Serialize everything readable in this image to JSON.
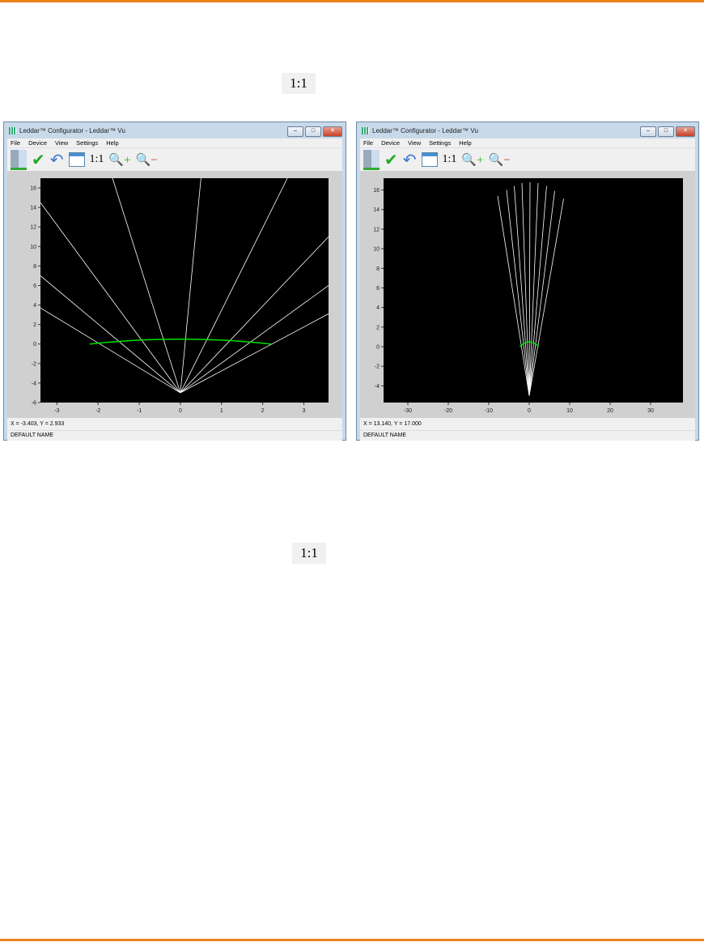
{
  "top_ratio_label": "1:1",
  "bottom_ratio_label": "1:1",
  "windows": [
    {
      "title": "Leddar™ Configurator - Leddar™ Vu",
      "menu": [
        "File",
        "Device",
        "View",
        "Settings",
        "Help"
      ],
      "toolbar_ratio": "1:1",
      "status_coords": "X = -3.403, Y = 2.933",
      "status_name": "DEFAULT NAME"
    },
    {
      "title": "Leddar™ Configurator - Leddar™ Vu",
      "menu": [
        "File",
        "Device",
        "View",
        "Settings",
        "Help"
      ],
      "toolbar_ratio": "1:1",
      "status_coords": "X = 13.140, Y = 17.000",
      "status_name": "DEFAULT NAME"
    }
  ],
  "colors": {
    "accent": "#f0821e",
    "plot_bg": "#000000",
    "rays": "#ffffff",
    "detection": "#00e000"
  },
  "chart_data": [
    {
      "type": "line",
      "xlim": [
        -3.4,
        3.6
      ],
      "ylim": [
        -6,
        17
      ],
      "xticks": [
        -3,
        -2,
        -1,
        0,
        1,
        2,
        3
      ],
      "yticks": [
        -6,
        -4,
        -2,
        0,
        2,
        4,
        6,
        8,
        10,
        12,
        14,
        16
      ],
      "origin": [
        0,
        -5
      ],
      "rays": [
        [
          -3.4,
          14.5
        ],
        [
          -3.4,
          7
        ],
        [
          -3.4,
          3.7
        ],
        [
          -1.65,
          17
        ],
        [
          0.5,
          17
        ],
        [
          2.6,
          17
        ],
        [
          3.6,
          11
        ],
        [
          3.6,
          6
        ],
        [
          3.6,
          3.1
        ]
      ],
      "arc": {
        "x": [
          -2.2,
          2.2
        ],
        "peak_y": 0.5,
        "edge_y": 0
      }
    },
    {
      "type": "line",
      "xlim": [
        -36,
        38
      ],
      "ylim": [
        -5.7,
        17.2
      ],
      "xticks": [
        -30,
        -20,
        -10,
        0,
        10,
        20,
        30
      ],
      "yticks": [
        -4,
        -2,
        0,
        2,
        4,
        6,
        8,
        10,
        12,
        14,
        16
      ],
      "origin": [
        0,
        -5
      ],
      "rays": [
        [
          -7.8,
          15.4
        ],
        [
          -5.6,
          16
        ],
        [
          -3.7,
          16.4
        ],
        [
          -1.8,
          16.7
        ],
        [
          0.2,
          16.8
        ],
        [
          2.2,
          16.7
        ],
        [
          4.3,
          16.4
        ],
        [
          6.3,
          15.9
        ],
        [
          8.5,
          15.1
        ]
      ],
      "arc": {
        "x": [
          -2.3,
          2.3
        ],
        "peak_y": 0.5,
        "edge_y": 0
      }
    }
  ]
}
